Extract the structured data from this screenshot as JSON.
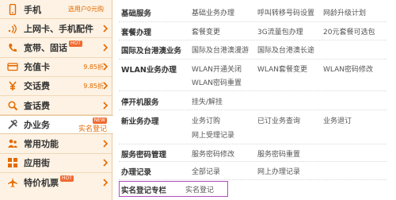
{
  "menu": {
    "items": [
      {
        "label": "手机",
        "promo": "选用户0元购",
        "icon": "mobile-phone-icon",
        "hot": ""
      },
      {
        "label": "上网卡、手机配件",
        "promo": "",
        "icon": "wifi-signal-icon",
        "hot": ""
      },
      {
        "label": "宽带、固话",
        "promo": "",
        "icon": "phone-handset-icon",
        "hot": "HOT"
      },
      {
        "label": "充值卡",
        "promo": "9.85折",
        "icon": "card-icon",
        "hot": ""
      },
      {
        "label": "交话费",
        "promo": "9.85折",
        "icon": "yen-icon",
        "hot": ""
      },
      {
        "label": "查话费",
        "promo": "",
        "icon": "magnifier-icon",
        "hot": ""
      },
      {
        "label": "办业务",
        "promo": "实名登记",
        "icon": "tools-icon",
        "hot": "",
        "tag": "NEW"
      },
      {
        "label": "常用功能",
        "promo": "",
        "icon": "people-icon",
        "hot": ""
      },
      {
        "label": "应用街",
        "promo": "",
        "icon": "apps-icon",
        "hot": ""
      },
      {
        "label": "特价机票",
        "promo": "",
        "icon": "airplane-icon",
        "hot": "HOT"
      }
    ]
  },
  "services": [
    {
      "category": "基础服务",
      "links": [
        "基础业务办理",
        "呼叫转移号码设置",
        "网龄升级计划"
      ]
    },
    {
      "category": "套餐办理",
      "links": [
        "套餐变更",
        "3G流量包办理",
        "20元套餐可选包"
      ]
    },
    {
      "category": "国际及台港澳业务",
      "links": [
        "国际及台港澳漫游",
        "国际及台港澳长途"
      ]
    },
    {
      "category": "WLAN业务办理",
      "links": [
        "WLAN开通关闭",
        "WLAN套餐变更",
        "WLAN密码修改",
        "WLAN密码重置"
      ]
    },
    {
      "category": "停开机服务",
      "links": [
        "挂失/解挂"
      ]
    },
    {
      "category": "新业务办理",
      "links": [
        "业务订购",
        "已订业务查询",
        "业务退订",
        "网上受理记录"
      ]
    },
    {
      "category": "服务密码管理",
      "links": [
        "服务密码修改",
        "服务密码重置"
      ]
    },
    {
      "category": "办理记录",
      "links": [
        "全部记录",
        "网上办理记录"
      ]
    },
    {
      "category": "实名登记专栏",
      "links": [
        "实名登记"
      ]
    }
  ],
  "colors": {
    "menu_bg": "#fdf2e3",
    "accent_orange": "#e36a00",
    "highlight_border": "#b34dbd"
  }
}
